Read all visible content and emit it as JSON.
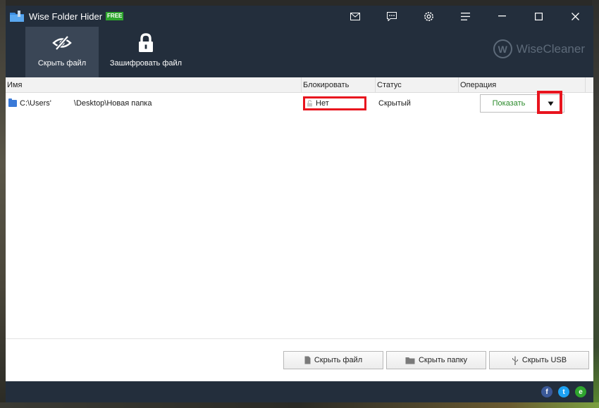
{
  "app": {
    "title": "Wise Folder Hider",
    "badge": "FREE",
    "brand": "WiseCleaner",
    "brand_letter": "W"
  },
  "titlebar_buttons": [
    "mail-icon",
    "feedback-icon",
    "settings-icon",
    "menu-icon",
    "minimize-icon",
    "maximize-icon",
    "close-icon"
  ],
  "toolbar": {
    "hide_file_label": "Скрыть файл",
    "encrypt_file_label": "Зашифровать файл"
  },
  "table": {
    "headers": {
      "name": "Имя",
      "lock": "Блокировать",
      "status": "Статус",
      "operation": "Операция"
    },
    "rows": [
      {
        "path_start": "C:\\Users'",
        "path_end": "\\Desktop\\Новая папка",
        "lock": "Нет",
        "status": "Скрытый",
        "operation": "Показать"
      }
    ]
  },
  "bottom": {
    "hide_file": "Скрыть файл",
    "hide_folder": "Скрыть папку",
    "hide_usb": "Скрыть USB"
  },
  "social": {
    "facebook": "f",
    "twitter": "t",
    "email": "e"
  },
  "colors": {
    "window": "#232e3c",
    "active_tool": "#3a4656",
    "highlight": "#e8141e",
    "show_text": "#2a8a2a",
    "free_badge": "#2ea52e",
    "facebook": "#3b5998",
    "twitter": "#1da1f2",
    "email": "#2ea52e"
  }
}
